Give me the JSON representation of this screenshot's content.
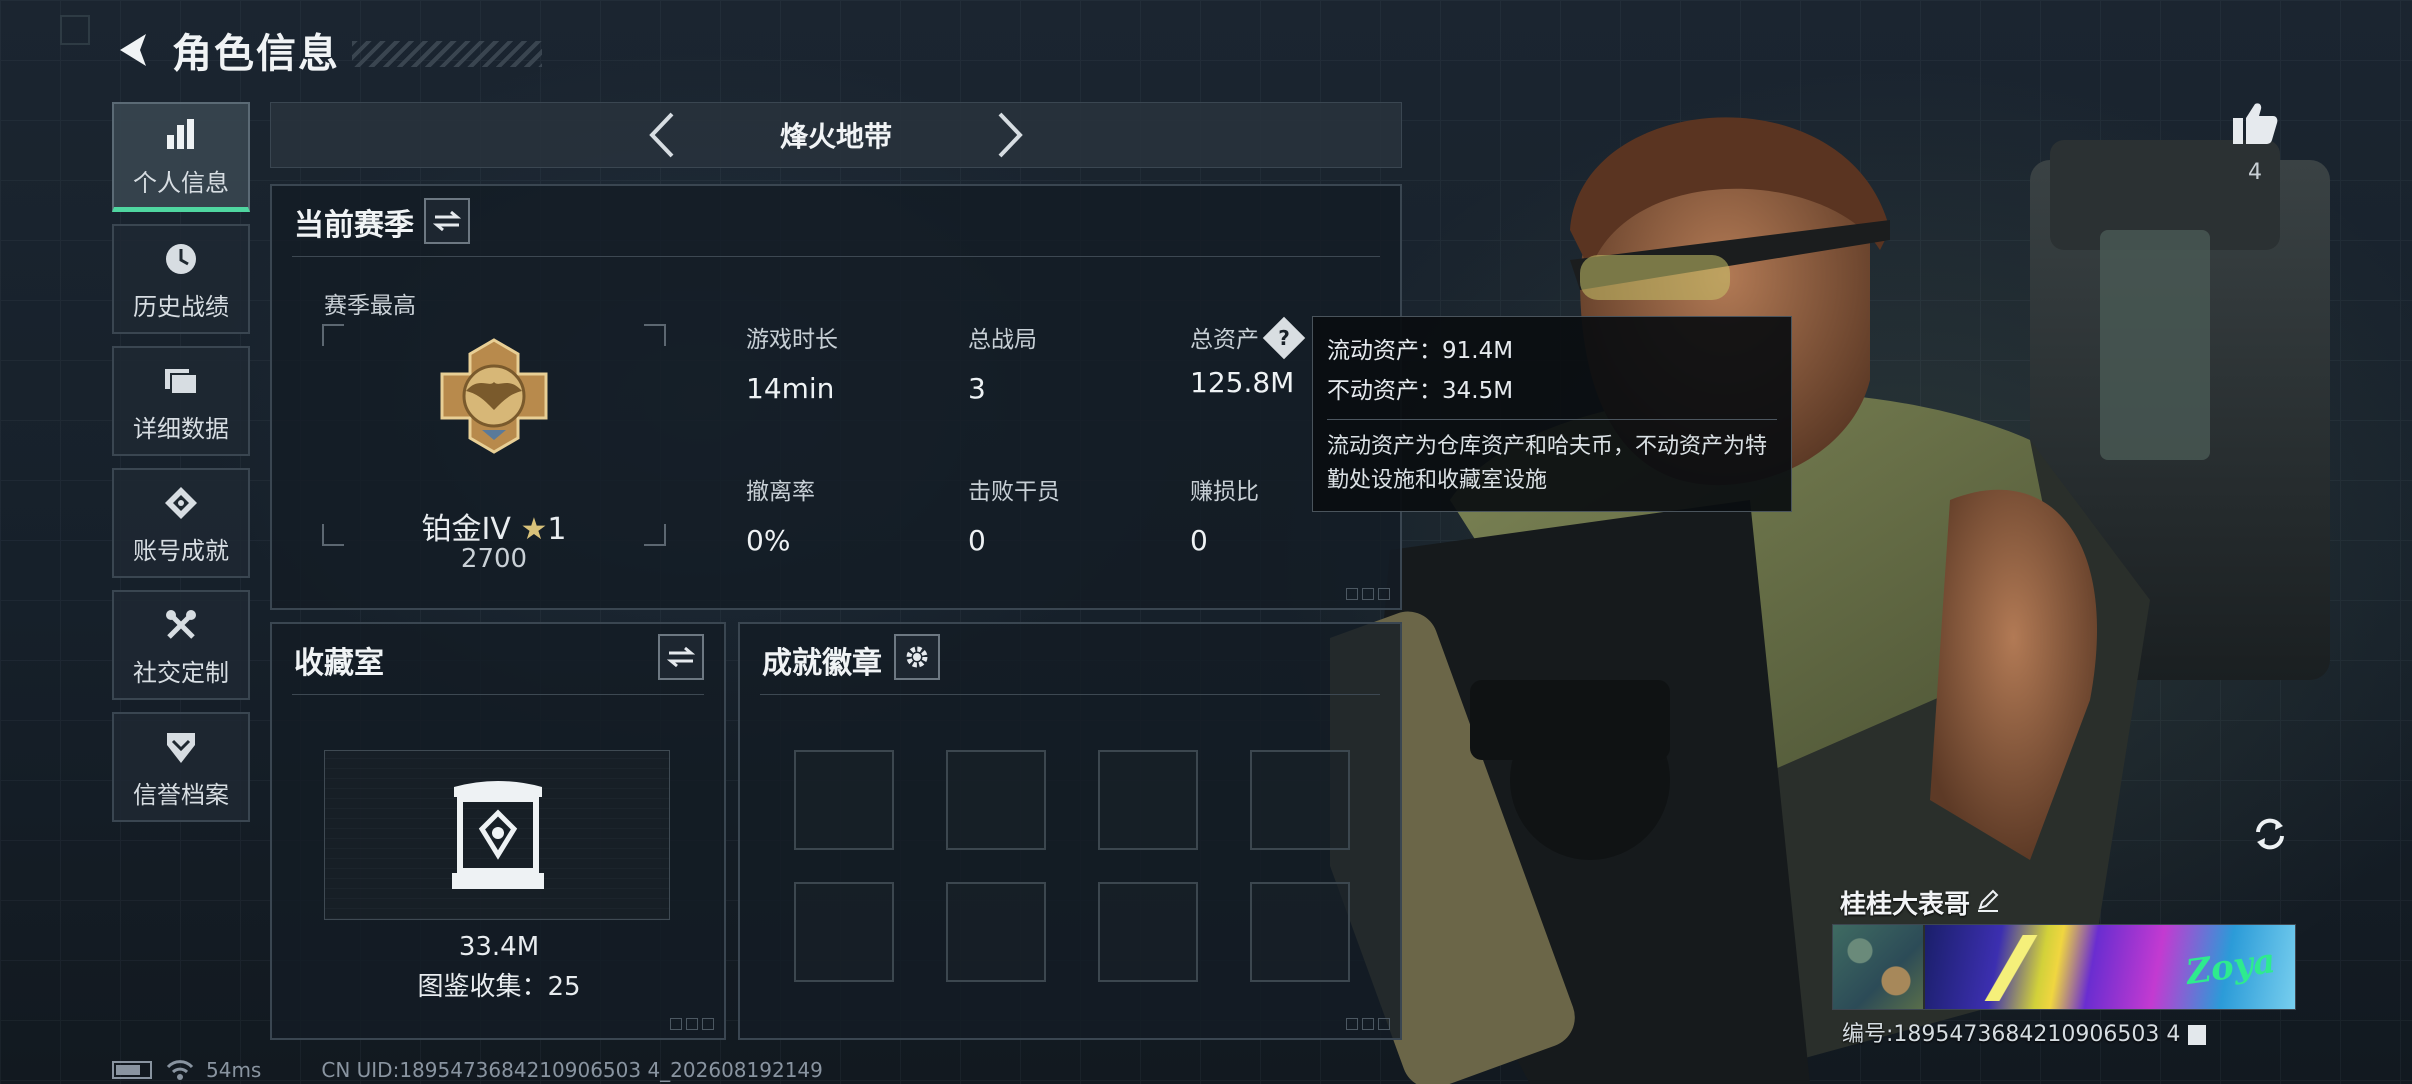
{
  "header": {
    "title": "角色信息"
  },
  "sidebar": {
    "items": [
      {
        "label": "个人信息",
        "icon": "bar-chart-icon",
        "active": true
      },
      {
        "label": "历史战绩",
        "icon": "history-clock-icon",
        "active": false
      },
      {
        "label": "详细数据",
        "icon": "folder-icon",
        "active": false
      },
      {
        "label": "账号成就",
        "icon": "achievement-icon",
        "active": false
      },
      {
        "label": "社交定制",
        "icon": "tools-icon",
        "active": false
      },
      {
        "label": "信誉档案",
        "icon": "shield-chevron-icon",
        "active": false
      }
    ]
  },
  "mode_selector": {
    "current": "烽火地带"
  },
  "season_panel": {
    "title": "当前赛季",
    "subtitle": "赛季最高",
    "rank": {
      "tier": "铂金IV",
      "stars": "1",
      "points": "2700"
    },
    "stats": [
      {
        "label": "游戏时长",
        "value": "14min"
      },
      {
        "label": "总战局",
        "value": "3"
      },
      {
        "label": "总资产",
        "value": "125.8M"
      },
      {
        "label": "撤离率",
        "value": "0%"
      },
      {
        "label": "击败干员",
        "value": "0"
      },
      {
        "label": "赚损比",
        "value": "0"
      }
    ],
    "help_symbol": "?"
  },
  "tooltip": {
    "liquid": "流动资产：91.4M",
    "fixed": "不动资产：34.5M",
    "desc": "流动资产为仓库资产和哈夫币，不动资产为特勤处设施和收藏室设施"
  },
  "collection_panel": {
    "title": "收藏室",
    "value": "33.4M",
    "count": "图鉴收集：25"
  },
  "badges_panel": {
    "title": "成就徽章",
    "slots": 8
  },
  "likes": {
    "count": "4"
  },
  "profile": {
    "nickname": "桂桂大表哥",
    "card_text": "Zoya",
    "uid": "编号:1895473684210906503 4"
  },
  "status_bar": {
    "ping": "54ms",
    "uid": "CN UID:1895473684210906503 4_202608192149"
  },
  "colors": {
    "accent": "#4fd6a0",
    "panel_border": "#3a4651",
    "background": "#151c23"
  }
}
